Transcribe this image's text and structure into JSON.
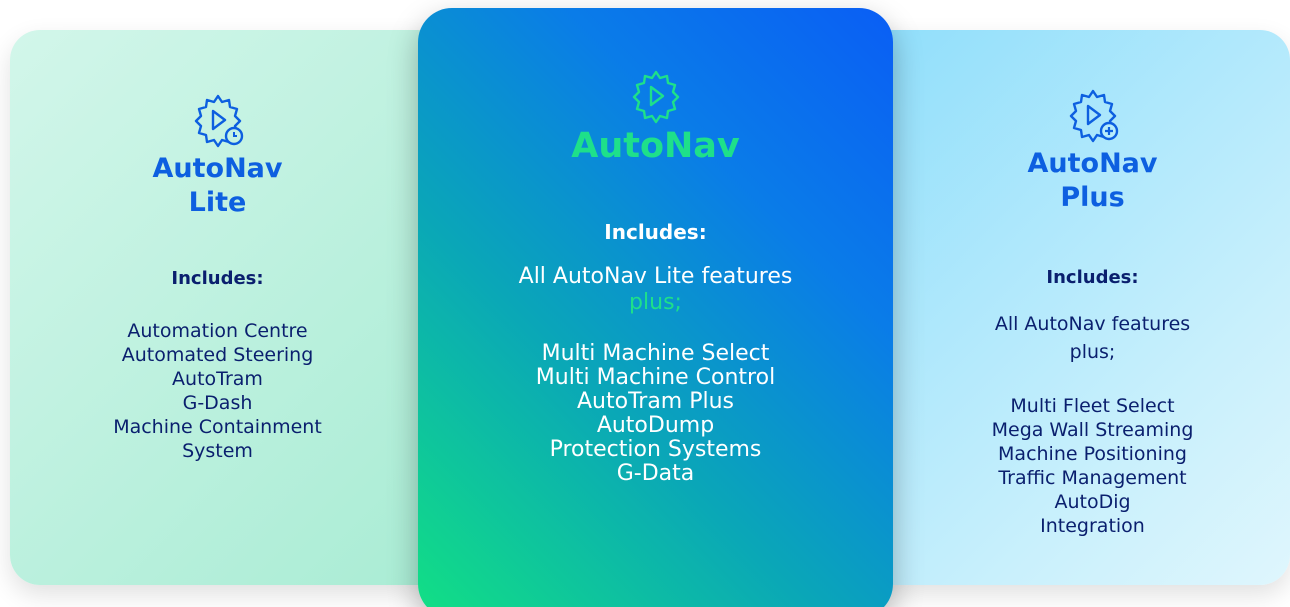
{
  "cards": {
    "lite": {
      "title_line1": "AutoNav",
      "title_line2": "Lite",
      "includes_label": "Includes:",
      "features": [
        "Automation Centre",
        "Automated Steering",
        "AutoTram",
        "G-Dash",
        "Machine Containment",
        "System"
      ],
      "icon": "gear-play-clock-icon"
    },
    "standard": {
      "title": "AutoNav",
      "includes_label": "Includes:",
      "lead": "All AutoNav Lite features",
      "lead_plus": "plus;",
      "features": [
        "Multi Machine Select",
        "Multi Machine Control",
        "AutoTram Plus",
        "AutoDump",
        "Protection Systems",
        "G-Data"
      ],
      "icon": "gear-play-icon"
    },
    "plus": {
      "title_line1": "AutoNav",
      "title_line2": "Plus",
      "includes_label": "Includes:",
      "lead_line1": "All AutoNav features",
      "lead_line2": "plus;",
      "features": [
        "Multi Fleet Select",
        "Mega Wall Streaming",
        "Machine Positioning",
        "Traffic Management",
        "AutoDig",
        "Integration"
      ],
      "icon": "gear-play-plus-icon"
    }
  },
  "colors": {
    "title_blue": "#0d5fe0",
    "text_navy": "#0a1f6e",
    "accent_green": "#1ee08a",
    "white": "#ffffff"
  }
}
